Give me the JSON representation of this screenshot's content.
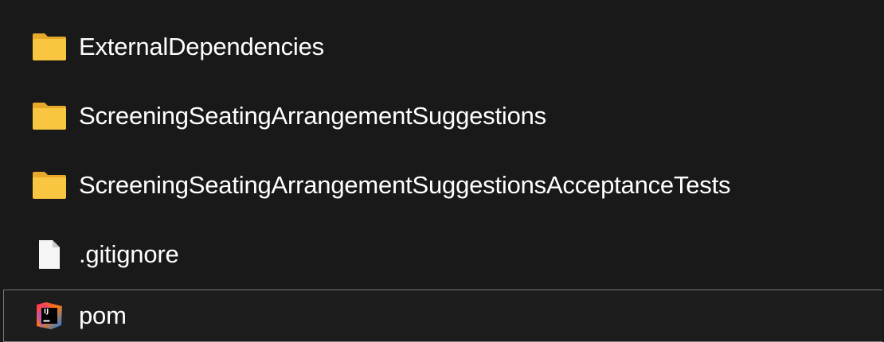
{
  "explorer": {
    "items": [
      {
        "name": "ExternalDependencies",
        "type": "folder",
        "icon": "folder-icon",
        "selected": false
      },
      {
        "name": "ScreeningSeatingArrangementSuggestions",
        "type": "folder",
        "icon": "folder-icon",
        "selected": false
      },
      {
        "name": "ScreeningSeatingArrangementSuggestionsAcceptanceTests",
        "type": "folder",
        "icon": "folder-icon",
        "selected": false
      },
      {
        "name": ".gitignore",
        "type": "file",
        "icon": "document-icon",
        "selected": false
      },
      {
        "name": "pom",
        "type": "file",
        "icon": "intellij-idea-icon",
        "icon_text": "IJ",
        "selected": true
      }
    ]
  },
  "colors": {
    "background": "#191919",
    "folder_body": "#f8c640",
    "folder_tab": "#e8a92a",
    "text": "#ffffff",
    "selection_border": "#7a7a7a"
  }
}
